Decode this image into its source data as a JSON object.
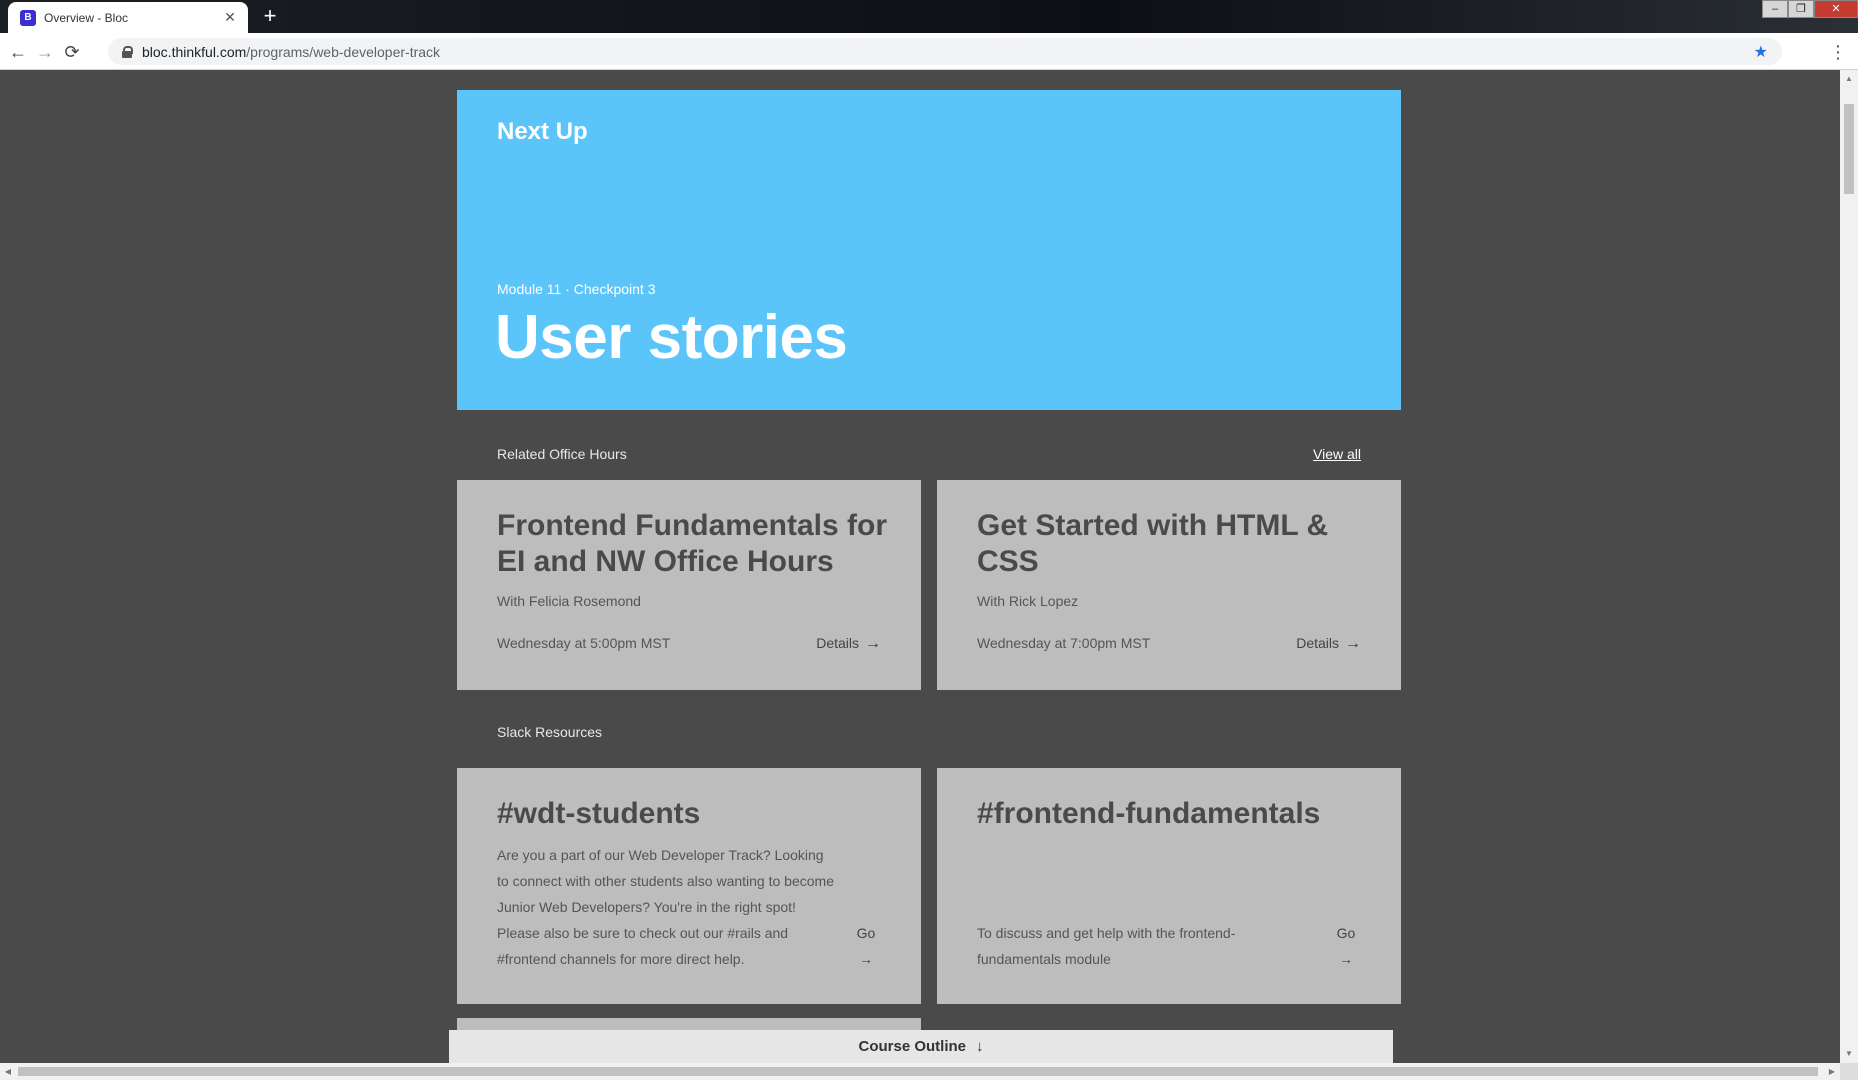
{
  "browser": {
    "tab_title": "Overview - Bloc",
    "favicon_letter": "B",
    "url_host": "bloc.thinkful.com",
    "url_path": "/programs/web-developer-track"
  },
  "hero": {
    "label": "Next Up",
    "meta": "Module 11 · Checkpoint 3",
    "title": "User stories"
  },
  "office_hours": {
    "heading": "Related Office Hours",
    "view_all": "View all",
    "cards": [
      {
        "title": "Frontend Fundamentals for EI and NW Office Hours",
        "host": "With Felicia Rosemond",
        "time": "Wednesday at 5:00pm MST",
        "details": "Details"
      },
      {
        "title": "Get Started with HTML & CSS",
        "host": "With Rick Lopez",
        "time": "Wednesday at 7:00pm MST",
        "details": "Details"
      }
    ]
  },
  "slack": {
    "heading": "Slack Resources",
    "cards": [
      {
        "title": "#wdt-students",
        "description": "Are you a part of our Web Developer Track? Looking to connect with other students also wanting to become Junior Web Developers? You're in the right spot! Please also be sure to check out our #rails and #frontend channels for more direct help.",
        "go": "Go"
      },
      {
        "title": "#frontend-fundamentals",
        "description": "To discuss and get help with the frontend-fundamentals module",
        "go": "Go"
      }
    ]
  },
  "course_outline": {
    "label": "Course Outline"
  },
  "icons": {
    "arrow_right": "→",
    "arrow_down": "↓"
  }
}
